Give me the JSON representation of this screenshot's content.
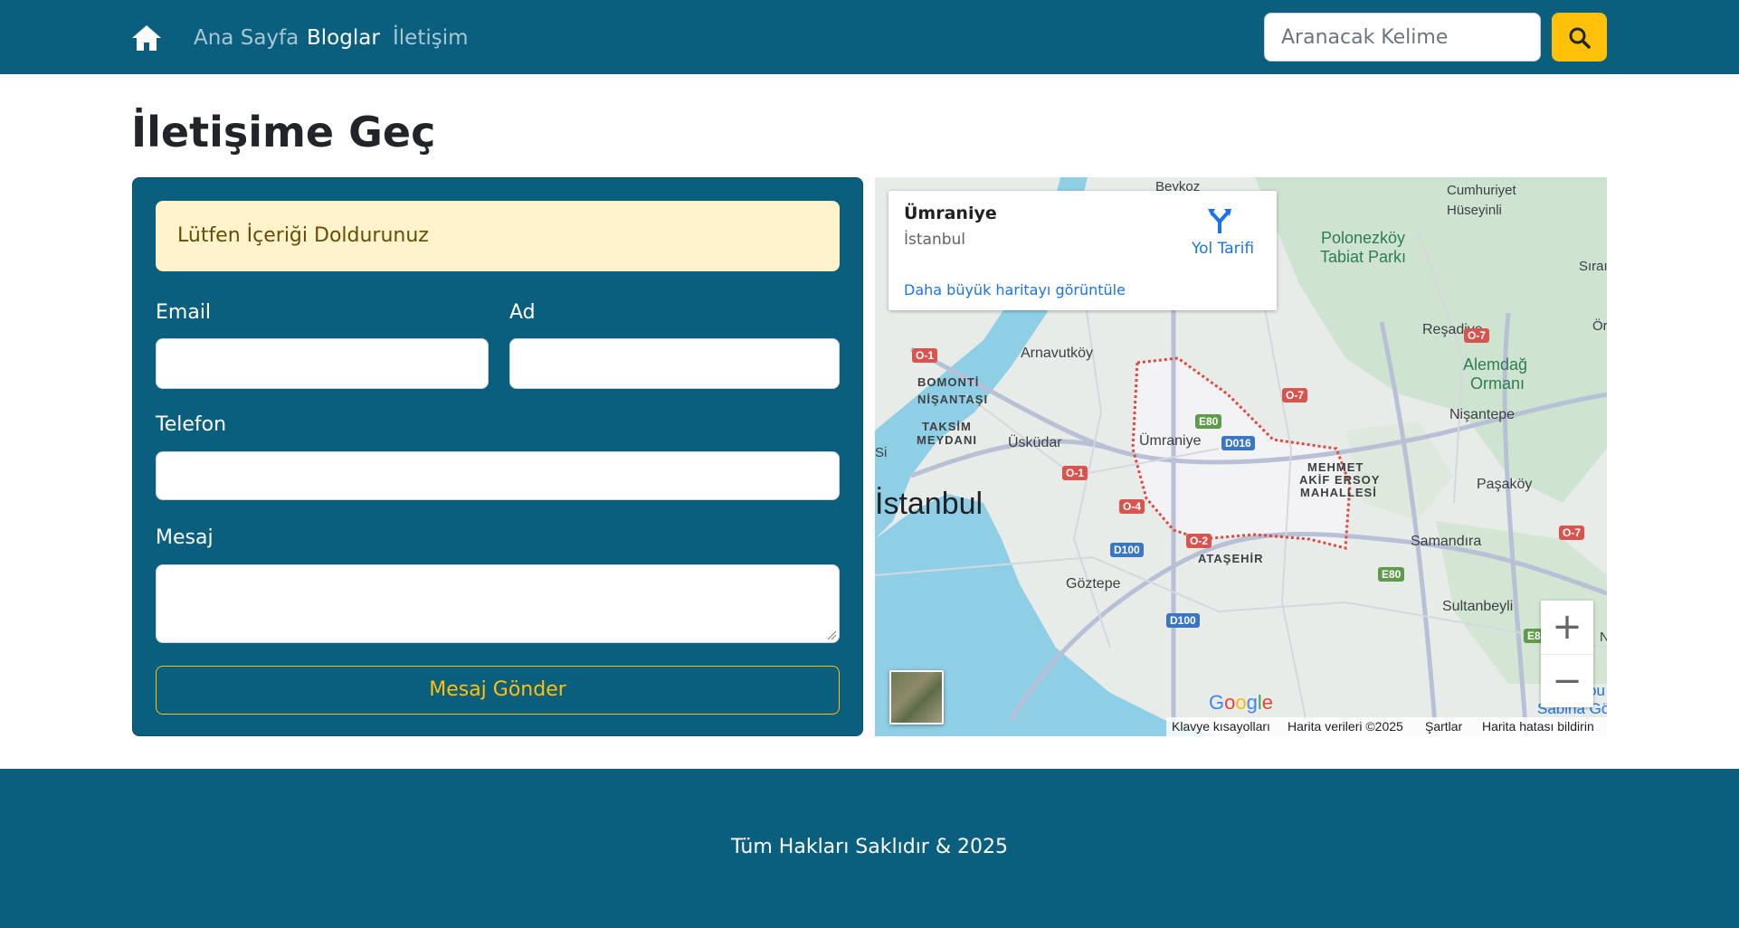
{
  "navbar": {
    "home_icon": "home-icon",
    "links": [
      "Ana Sayfa",
      "Bloglar",
      "İletişim"
    ],
    "search_placeholder": "Aranacak Kelime",
    "search_icon": "search-icon",
    "colors": {
      "background": "#0a5f7e",
      "accent": "#ffc107"
    }
  },
  "page": {
    "title": "İletişime Geç"
  },
  "form": {
    "alert": "Lütfen İçeriği Doldurunuz",
    "email_label": "Email",
    "email_value": "",
    "name_label": "Ad",
    "name_value": "",
    "phone_label": "Telefon",
    "phone_value": "",
    "message_label": "Mesaj",
    "message_value": "",
    "submit_label": "Mesaj Gönder"
  },
  "map": {
    "place_title": "Ümraniye",
    "place_subtitle": "İstanbul",
    "directions_label": "Yol Tarifi",
    "directions_icon": "directions-icon",
    "larger_map_link": "Daha büyük haritayı görüntüle",
    "zoom_in": "+",
    "zoom_out": "−",
    "google_logo": "Google",
    "attribution": {
      "shortcuts": "Klavye kısayolları",
      "data": "Harita verileri ©2025",
      "terms": "Şartlar",
      "report": "Harita hatası bildirin"
    },
    "labels": {
      "beykoz": "Beykoz",
      "cumhuriyet": "Cumhuriyet",
      "huseyinli": "Hüseyinli",
      "sira": "Sıraı",
      "polonezkoy": "Polonezköy",
      "tabiat_parki": "Tabiat Parkı",
      "resadiye": "Reşadiye",
      "or": "Ör",
      "alemdag": "Alemdağ",
      "ormani": "Ormanı",
      "arnavutkoy": "Arnavutköy",
      "bomonti": "BOMONTİ",
      "nisantasi": "NİŞANTAŞI",
      "taksim": "TAKSİM",
      "meydani": "MEYDANI",
      "uskudar": "Üsküdar",
      "umraniye": "Ümraniye",
      "nisantepe": "Nişantepe",
      "mehmet": "MEHMET",
      "akif_ersoy": "AKİF ERSOY",
      "mahallesi": "MAHALLESİ",
      "pasakoy": "Paşaköy",
      "istanbul": "İstanbul",
      "samandira": "Samandıra",
      "atasehir": "ATAŞEHİR",
      "goztepe": "Göztepe",
      "sultanbeyli": "Sultanbeyli",
      "sabiha": "Sabiha Gök",
      "si": "Si",
      "ou": "ou",
      "n": "N"
    },
    "shields": {
      "o1_a": "O-1",
      "o1_b": "O-1",
      "o7_a": "O-7",
      "o7_b": "O-7",
      "o7_c": "O-7",
      "e80_a": "E80",
      "e80_b": "E80",
      "e8": "E8",
      "d016": "D016",
      "o4": "O-4",
      "o2": "O-2",
      "d100_a": "D100",
      "d100_b": "D100"
    }
  },
  "footer": {
    "text": "Tüm Hakları Saklıdır & 2025"
  }
}
